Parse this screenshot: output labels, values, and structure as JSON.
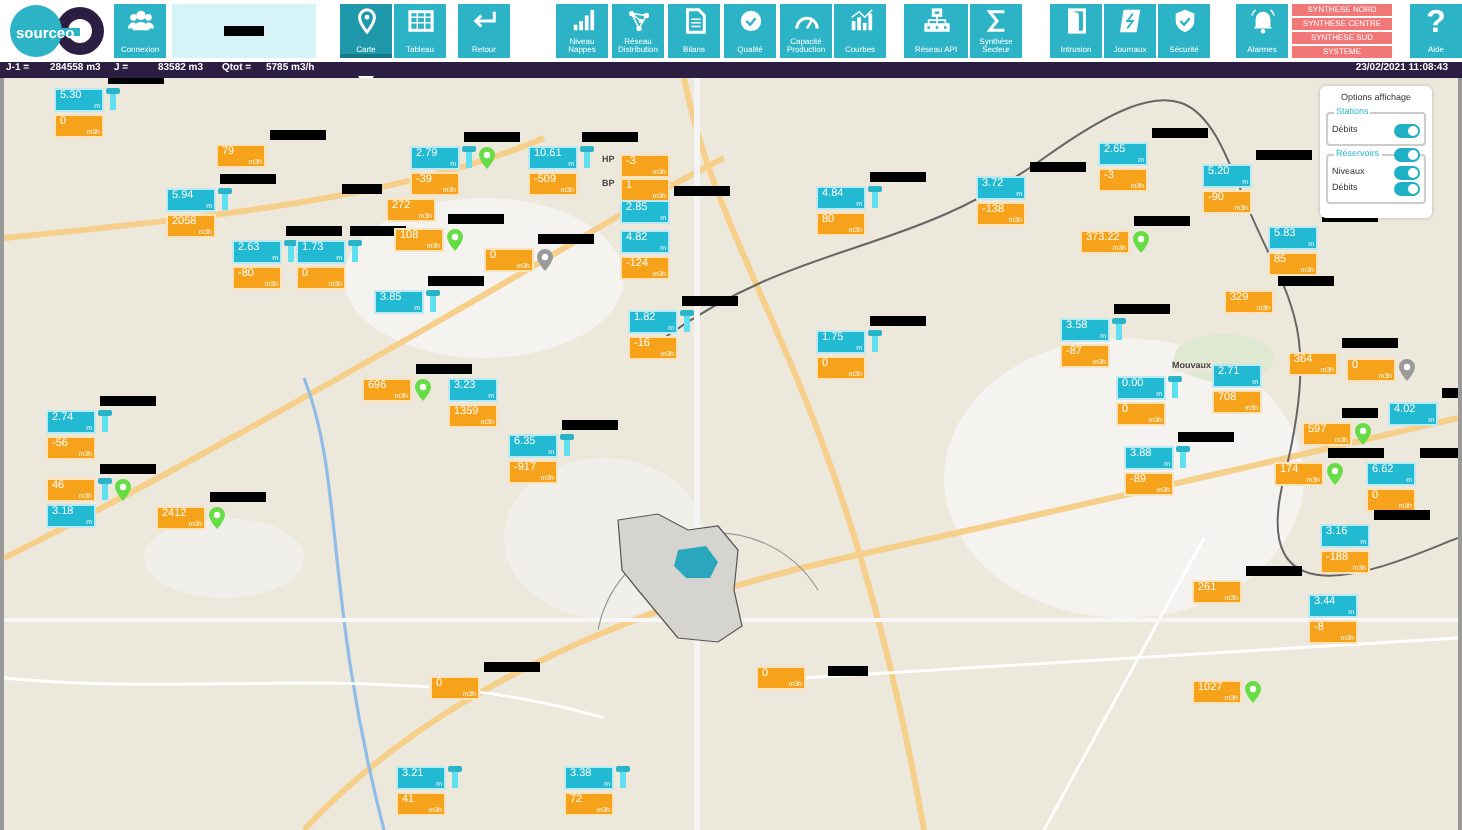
{
  "toolbar": {
    "logo": "sourceo",
    "items": [
      {
        "kind": "button",
        "label": "Connexion",
        "selected": false
      },
      {
        "kind": "panel",
        "name_hidden": true
      },
      {
        "kind": "button",
        "label": "Carte",
        "selected": true
      },
      {
        "kind": "button",
        "label": "Tableau",
        "selected": false
      },
      {
        "kind": "button",
        "label": "Retour",
        "selected": false
      },
      {
        "kind": "button",
        "label": "Niveau Nappes",
        "selected": false
      },
      {
        "kind": "button",
        "label": "Réseau Distribution",
        "selected": false
      },
      {
        "kind": "button",
        "label": "Bilans",
        "selected": false
      },
      {
        "kind": "button",
        "label": "Qualité",
        "selected": false
      },
      {
        "kind": "button",
        "label": "Capacité Production",
        "selected": false
      },
      {
        "kind": "button",
        "label": "Courbes",
        "selected": false
      },
      {
        "kind": "button",
        "label": "Réseau API",
        "selected": false
      },
      {
        "kind": "button",
        "label": "Synthèse Secteur",
        "selected": false
      },
      {
        "kind": "button",
        "label": "Intrusion",
        "selected": false
      },
      {
        "kind": "button",
        "label": "Journaux",
        "selected": false
      },
      {
        "kind": "button",
        "label": "Sécurité",
        "selected": false
      },
      {
        "kind": "button",
        "label": "Alarmes",
        "selected": false
      },
      {
        "kind": "links",
        "items": [
          "SYNTHESE NORD",
          "SYNTHESE CENTRE",
          "SYNTHESE SUD",
          "SYSTEME"
        ]
      },
      {
        "kind": "button",
        "label": "Aide",
        "glyph": "?",
        "selected": false
      }
    ]
  },
  "stats": [
    {
      "label": "J-1 =",
      "value": "284558 m3"
    },
    {
      "label": "J =",
      "value": "83582 m3"
    },
    {
      "label": "Qtot =",
      "value": "5785 m3/h"
    }
  ],
  "datetime": "23/02/2021 11:08:43",
  "options": {
    "title": "Options affichage",
    "sections": [
      {
        "legend": "Stations",
        "toggles": [
          {
            "label": "Débits",
            "on": true
          }
        ]
      },
      {
        "legend": "Réservoirs",
        "legend_on": true,
        "toggles": [
          {
            "label": "Niveaux",
            "on": true
          },
          {
            "label": "Débits",
            "on": true
          }
        ]
      }
    ]
  },
  "labels": [
    {
      "text": "HP"
    },
    {
      "text": "BP"
    },
    {
      "text": "Mouvaux"
    }
  ],
  "markers": [
    {
      "level": "5.30",
      "level_unit": "m",
      "flow": "0",
      "flow_unit": "m3h",
      "pump": true,
      "name_hidden": true
    },
    {
      "flow": "79",
      "flow_unit": "m3h",
      "name_hidden": true
    },
    {
      "level": "5.94",
      "level_unit": "m",
      "flow": "2058",
      "flow_unit": "m3h",
      "pump": true,
      "name_hidden": true
    },
    {
      "level": "2.63",
      "level_unit": "m",
      "flow": "-80",
      "flow_unit": "m3h",
      "pump": true,
      "name_hidden": true
    },
    {
      "level": "1.73",
      "level_unit": "m",
      "flow": "0",
      "flow_unit": "m3h",
      "pump": true,
      "name_hidden": true
    },
    {
      "level": "2.79",
      "level_unit": "m",
      "flow": "-39",
      "flow_unit": "m3h",
      "pump": true,
      "color": "#66dd44",
      "name_hidden": true
    },
    {
      "flow": "272",
      "flow_unit": "m3h",
      "name_hidden": true
    },
    {
      "flow": "108",
      "flow_unit": "m3h",
      "color": "#66dd44",
      "name_hidden": true
    },
    {
      "flow": "0",
      "flow_unit": "m3h",
      "color": "#9a9a9a",
      "name_hidden": true
    },
    {
      "level": "10.61",
      "level_unit": "m",
      "flow": "-509",
      "flow_unit": "m3h",
      "pump": true,
      "name_hidden": true
    },
    {
      "flow": "-3",
      "flow_unit": "m3h"
    },
    {
      "flow": "1",
      "flow_unit": "m3h"
    },
    {
      "level": "2.85",
      "level_unit": "m",
      "name_hidden": true
    },
    {
      "level": "4.82",
      "level_unit": "m",
      "flow": "-124",
      "flow_unit": "m3h"
    },
    {
      "level": "3.85",
      "level_unit": "m",
      "pump": true,
      "name_hidden": true
    },
    {
      "level": "1.82",
      "level_unit": "m",
      "flow": "-16",
      "flow_unit": "m3h",
      "pump": true,
      "name_hidden": true
    },
    {
      "level": "4.84",
      "level_unit": "m",
      "flow": "80",
      "flow_unit": "m3h",
      "pump": true,
      "name_hidden": true
    },
    {
      "level": "3.72",
      "level_unit": "m",
      "flow": "-138",
      "flow_unit": "m3h",
      "name_hidden": true
    },
    {
      "level": "2.65",
      "level_unit": "m",
      "flow": "-3",
      "flow_unit": "m3h",
      "name_hidden": true
    },
    {
      "level": "5.20",
      "level_unit": "m",
      "flow": "-90",
      "flow_unit": "m3h",
      "name_hidden": true
    },
    {
      "flow": "373.22",
      "flow_unit": "m3h",
      "color": "#66dd44",
      "name_hidden": true
    },
    {
      "level": "5.83",
      "level_unit": "m",
      "flow": "85",
      "flow_unit": "m3h",
      "name_hidden": true
    },
    {
      "flow": "329",
      "flow_unit": "m3h",
      "name_hidden": true
    },
    {
      "flow": "696",
      "flow_unit": "m3h",
      "color": "#66dd44",
      "name_hidden": true
    },
    {
      "level": "3.23",
      "level_unit": "m",
      "flow": "1359",
      "flow_unit": "m3h"
    },
    {
      "level": "2.74",
      "level_unit": "m",
      "flow": "-56",
      "flow_unit": "m3h",
      "pump": true,
      "name_hidden": true
    },
    {
      "flow": "46",
      "flow_unit": "m3h",
      "level": "3.18",
      "level_unit": "m",
      "flow_first": true,
      "color": "#66dd44",
      "pump": true,
      "name_hidden": true
    },
    {
      "flow": "2412",
      "flow_unit": "m3h",
      "color": "#66dd44",
      "name_hidden": true
    },
    {
      "level": "6.35",
      "level_unit": "m",
      "flow": "-917",
      "flow_unit": "m3h",
      "pump": true,
      "name_hidden": true
    },
    {
      "level": "1.75",
      "level_unit": "m",
      "flow": "0",
      "flow_unit": "m3h",
      "pump": true,
      "name_hidden": true
    },
    {
      "level": "3.58",
      "level_unit": "m",
      "flow": "-87",
      "flow_unit": "m3h",
      "pump": true,
      "name_hidden": true
    },
    {
      "level": "0.00",
      "level_unit": "m",
      "flow": "0",
      "flow_unit": "m3h",
      "pump": true
    },
    {
      "level": "2.71",
      "level_unit": "m",
      "flow": "708",
      "flow_unit": "m3h"
    },
    {
      "flow": "364",
      "flow_unit": "m3h",
      "name_hidden": true
    },
    {
      "flow": "0",
      "flow_unit": "m3h",
      "color": "#9a9a9a"
    },
    {
      "level": "4.02",
      "level_unit": "m",
      "name_hidden": true
    },
    {
      "flow": "597",
      "flow_unit": "m3h",
      "color": "#66dd44",
      "name_hidden": true
    },
    {
      "level": "3.88",
      "level_unit": "m",
      "flow": "-89",
      "flow_unit": "m3h",
      "pump": true,
      "name_hidden": true
    },
    {
      "flow": "174",
      "flow_unit": "m3h",
      "color": "#66dd44",
      "name_hidden": true
    },
    {
      "level": "6.62",
      "level_unit": "m",
      "flow": "0",
      "flow_unit": "m3h",
      "name_hidden": true
    },
    {
      "level": "3.16",
      "level_unit": "m",
      "flow": "-188",
      "flow_unit": "m3h",
      "name_hidden": true
    },
    {
      "flow": "261",
      "flow_unit": "m3h",
      "name_hidden": true
    },
    {
      "level": "3.44",
      "level_unit": "m",
      "flow": "-8",
      "flow_unit": "m3h"
    },
    {
      "flow": "0",
      "flow_unit": "m3h",
      "name_hidden": true
    },
    {
      "flow": "1027",
      "flow_unit": "m3h",
      "color": "#66dd44"
    },
    {
      "flow": "0",
      "flow_unit": "m3h",
      "name_hidden": true
    },
    {
      "level": "3.21",
      "level_unit": "m",
      "flow": "41",
      "flow_unit": "m3h",
      "pump": true
    },
    {
      "level": "3.38",
      "level_unit": "m",
      "flow": "72",
      "flow_unit": "m3h",
      "pump": true
    }
  ]
}
